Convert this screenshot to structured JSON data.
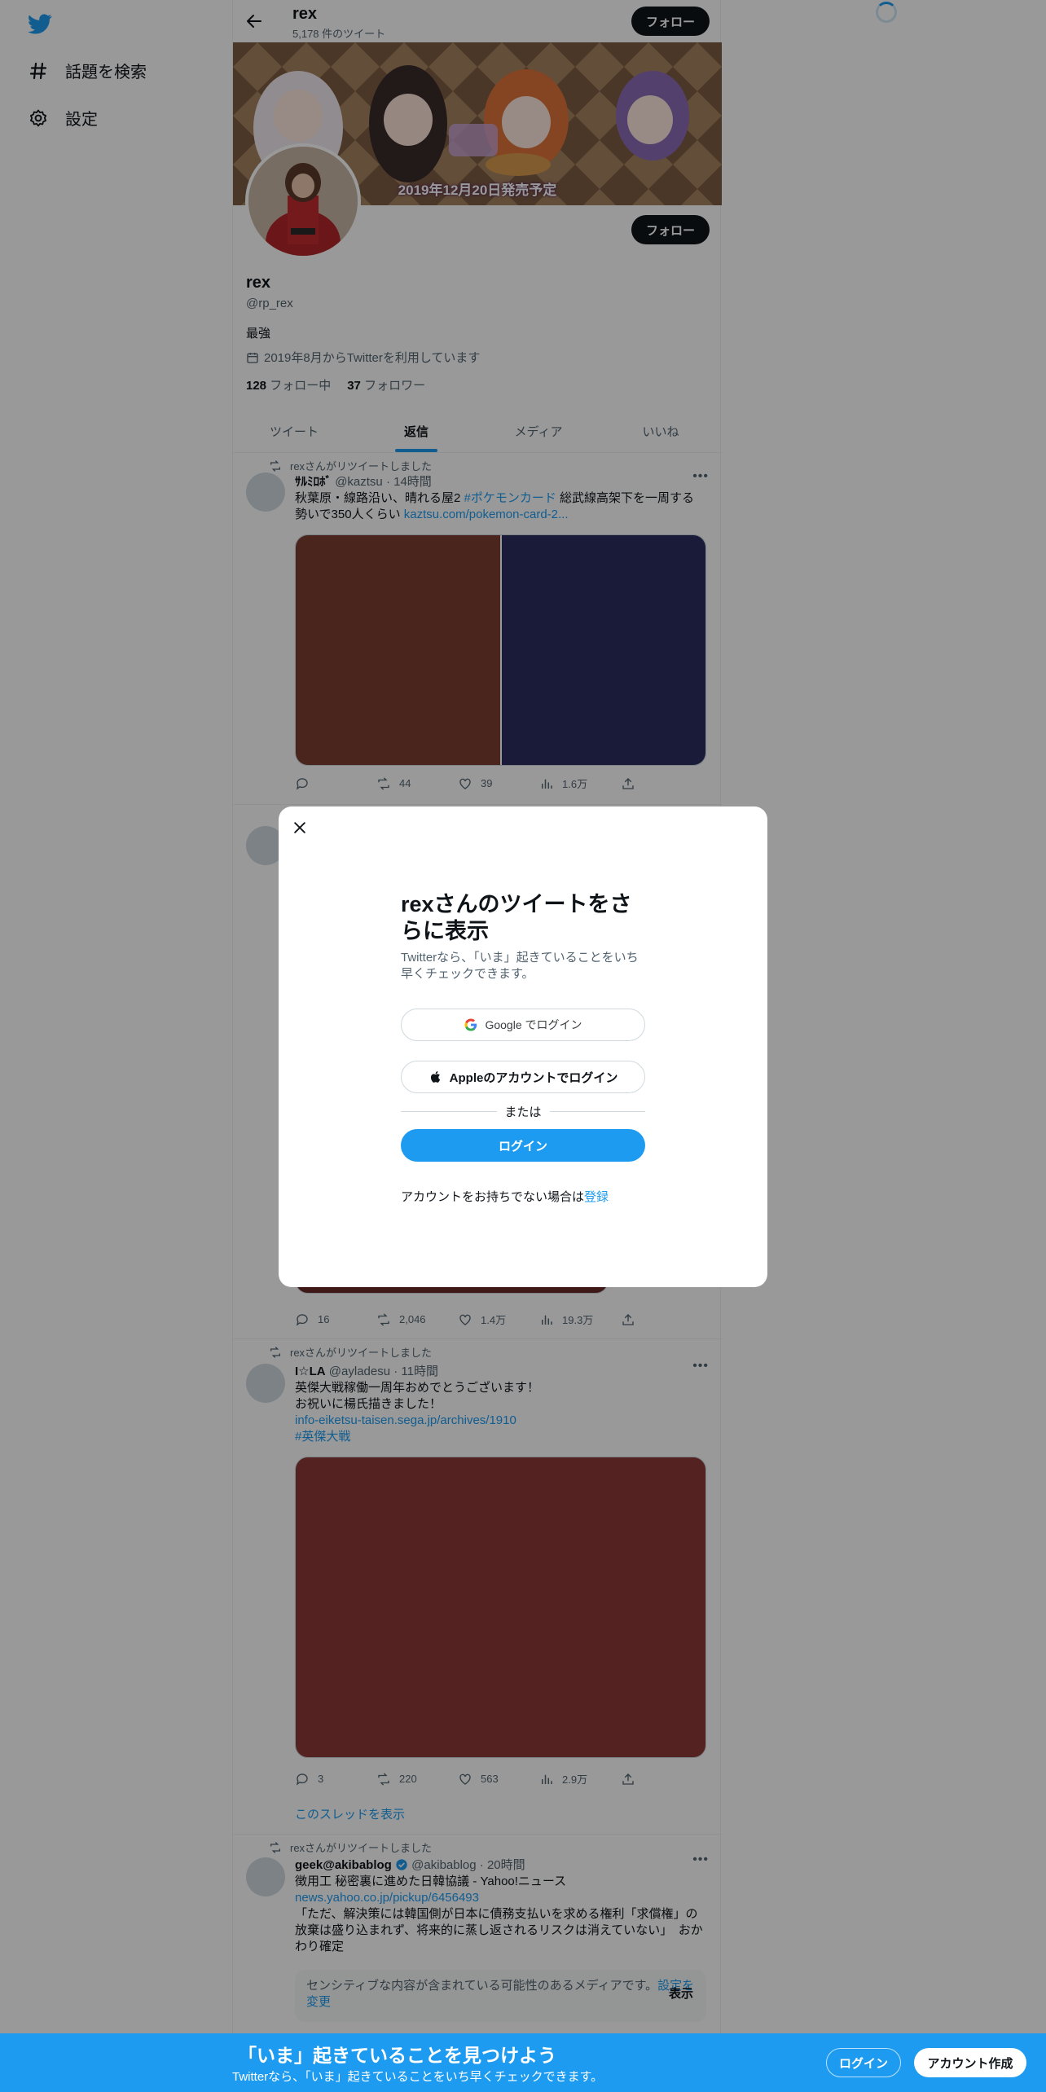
{
  "nav": {
    "explore_label": "話題を検索",
    "settings_label": "設定"
  },
  "header": {
    "name": "rex",
    "tweet_count": "5,178 件のツイート",
    "follow_label": "フォロー"
  },
  "banner": {
    "date_text": "2019年12月20日発売予定"
  },
  "profile": {
    "name": "rex",
    "handle": "@rp_rex",
    "bio": "最強",
    "joined": "2019年8月からTwitterを利用しています",
    "following_count": "128",
    "following_label": "フォロー中",
    "followers_count": "37",
    "followers_label": "フォロワー",
    "follow_label": "フォロー"
  },
  "tabs": [
    {
      "label": "ツイート"
    },
    {
      "label": "返信"
    },
    {
      "label": "メディア"
    },
    {
      "label": "いいね"
    }
  ],
  "tweets": [
    {
      "retweet_label": "rexさんがリツイートしました",
      "display_name": "ｻﾙﾐﾛﾎﾞ",
      "handle": "@kaztsu",
      "time": "14時間",
      "text_1": "秋葉原・線路沿い、晴れる屋2 ",
      "hashtag": "#ポケモンカード",
      "text_2": " 総武線高架下を一周する勢いで350人くらい ",
      "link": "kaztsu.com/pokemon-card-2...",
      "media_colors": [
        "#7a3f31",
        "#2b2d5e"
      ],
      "reply": "",
      "retweets": "44",
      "likes": "39",
      "views": "1.6万"
    },
    {
      "reply": "16",
      "retweets": "2,046",
      "likes": "1.4万",
      "views": "19.3万",
      "media_color": "#6a2a28"
    },
    {
      "retweet_label": "rexさんがリツイートしました",
      "display_name": "I☆LA",
      "handle": "@ayladesu",
      "time": "11時間",
      "line_1": "英傑大戦稼働一周年おめでとうございます！",
      "line_2": "お祝いに楊氏描きました！",
      "link": "info-eiketsu-taisen.sega.jp/archives/1910",
      "hashtag": "#英傑大戦",
      "media_color": "#8b3a37",
      "reply": "3",
      "retweets": "220",
      "likes": "563",
      "views": "2.9万",
      "thread_label": "このスレッドを表示"
    },
    {
      "retweet_label": "rexさんがリツイートしました",
      "display_name": "geek@akibablog",
      "handle": "@akibablog",
      "time": "20時間",
      "line_1": "徴用工 秘密裏に進めた日韓協議 - Yahoo!ニュース",
      "link": "news.yahoo.co.jp/pickup/6456493",
      "line_2": "「ただ、解決策には韓国側が日本に債務支払いを求める権利「求償権」の放棄は盛り込まれず、将来的に蒸し返されるリスクは消えていない」　おかわり確定",
      "sensitive_text": "センシティブな内容が含まれている可能性のあるメディアです。",
      "sensitive_link": "設定を変更",
      "show_label": "表示"
    }
  ],
  "modal": {
    "title": "rexさんのツイートをさらに表示",
    "description": "Twitterなら、「いま」起きていることをいち早くチェックできます。",
    "google_label": "Google でログイン",
    "apple_label": "Appleのアカウントでログイン",
    "or_label": "または",
    "login_label": "ログイン",
    "signup_prompt": "アカウントをお持ちでない場合は",
    "signup_link": "登録"
  },
  "bottom_bar": {
    "title": "「いま」起きていることを見つけよう",
    "subtitle": "Twitterなら、「いま」起きていることをいち早くチェックできます。",
    "login_label": "ログイン",
    "signup_label": "アカウント作成"
  },
  "colors": {
    "accent": "#1d9bf0",
    "text": "#0f1419",
    "muted": "#536471"
  }
}
